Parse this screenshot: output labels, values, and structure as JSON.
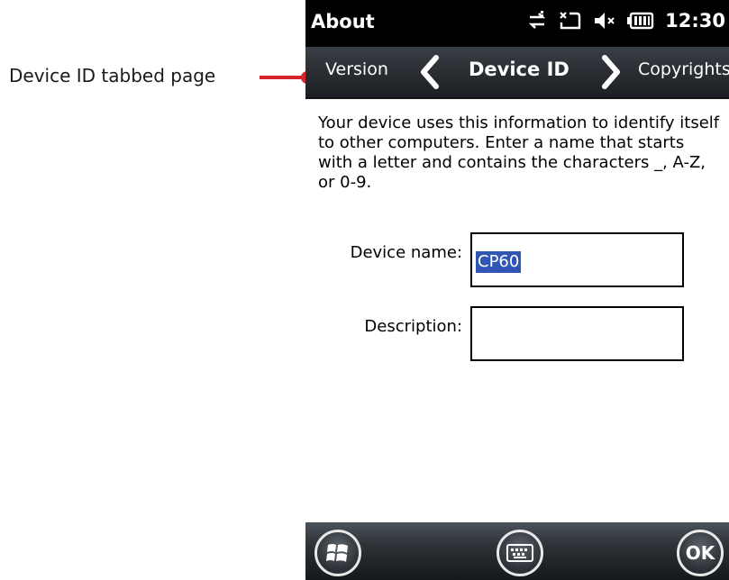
{
  "annotation": {
    "label": "Device ID tabbed page",
    "accent_color": "#d8232a"
  },
  "status_bar": {
    "title": "About",
    "icons": [
      "sync-icon",
      "no-signal-icon",
      "speaker-muted-icon",
      "battery-icon"
    ],
    "time": "12:30"
  },
  "tabs": {
    "previous": "Version",
    "current": "Device ID",
    "next": "Copyrights"
  },
  "content": {
    "intro": "Your device uses this information to identify itself to other computers. Enter a name that starts with a letter and contains the characters _, A-Z, or 0-9.",
    "device_name_label": "Device name:",
    "device_name_value": "CP60",
    "description_label": "Description:",
    "description_value": ""
  },
  "bottom_bar": {
    "start_icon": "windows-start-icon",
    "keyboard_icon": "keyboard-icon",
    "ok_label": "OK"
  },
  "colors": {
    "selection": "#2f55b5",
    "status_bar": "#000000"
  }
}
